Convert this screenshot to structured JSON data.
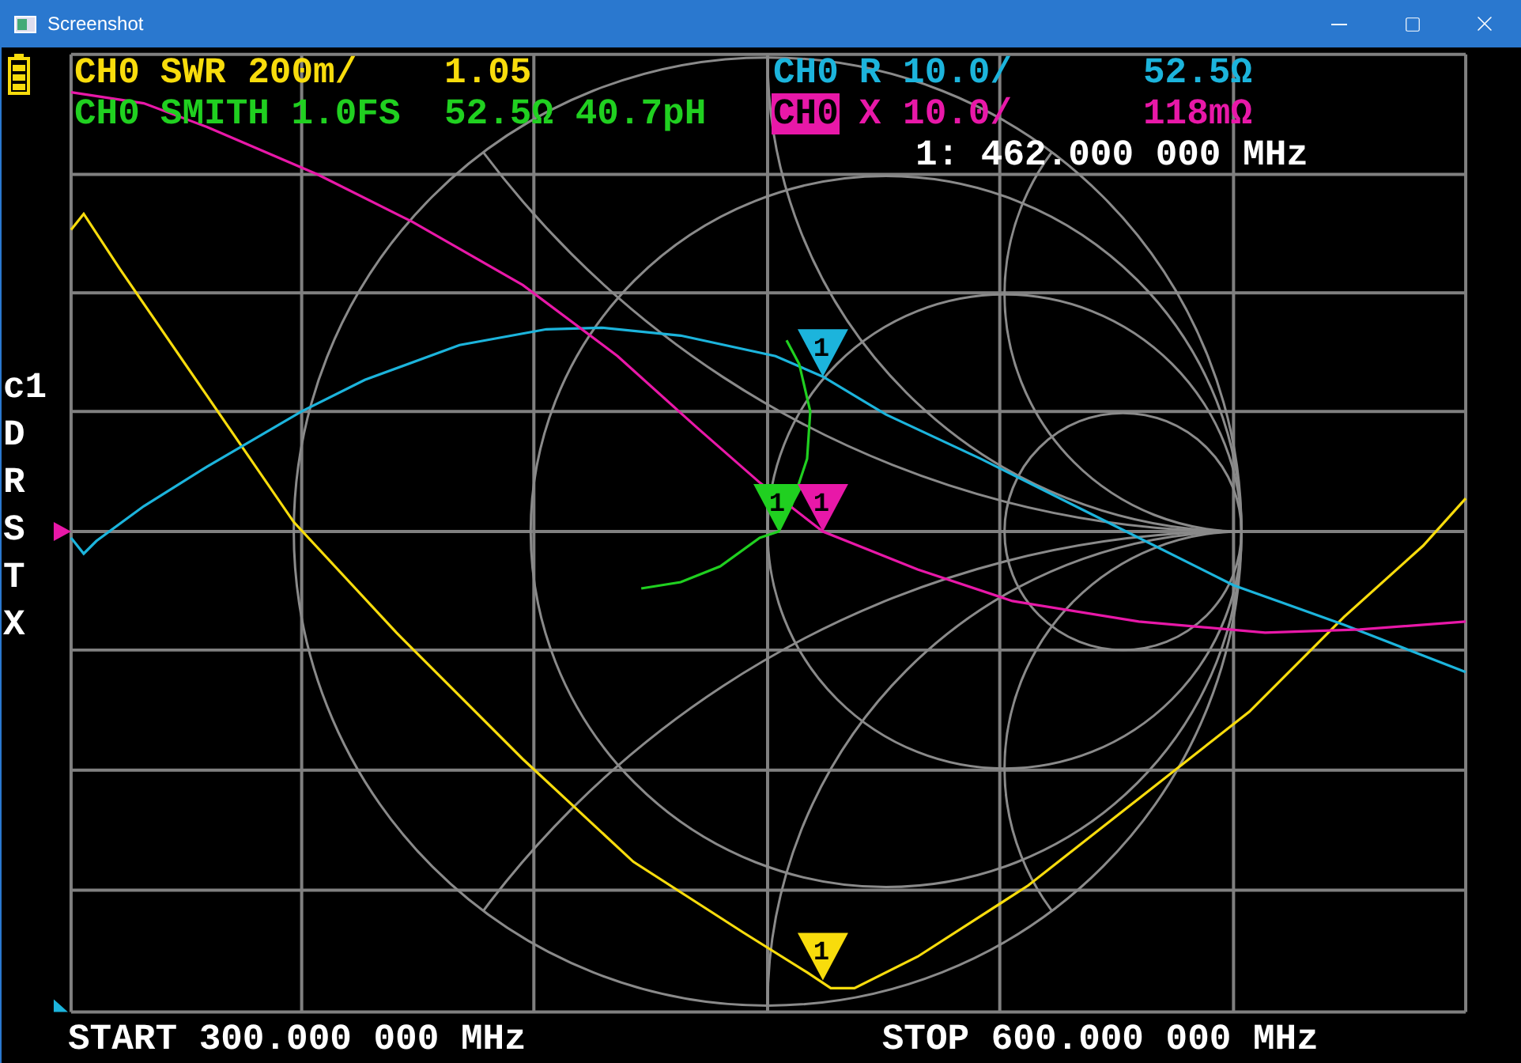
{
  "window": {
    "title": "Screenshot"
  },
  "traces": [
    {
      "channel": "CH0",
      "format": "SWR 200m/",
      "value": "1.05",
      "color": "#f8dc0c",
      "selected": false
    },
    {
      "channel": "CH0",
      "format": "R 10.0/",
      "value": "52.5Ω",
      "color": "#1cb4dc",
      "selected": false
    },
    {
      "channel": "CH0",
      "format": "SMITH 1.0FS",
      "value": "52.5Ω 40.7pH",
      "color": "#20d020",
      "selected": false
    },
    {
      "channel": "CH0",
      "format": "X 10.0/",
      "value": "118mΩ",
      "color": "#e818a8",
      "selected": true
    }
  ],
  "markers": [
    {
      "label": "1",
      "color": "#1cb4dc"
    },
    {
      "label": "1",
      "color": "#20d020"
    },
    {
      "label": "1",
      "color": "#e818a8"
    },
    {
      "label": "1",
      "color": "#f8dc0c"
    }
  ],
  "marker_readout": "1: 462.000 000 MHz",
  "side_menu": [
    "c1",
    "D",
    "R",
    "S",
    "T",
    "X"
  ],
  "start": "START 300.000 000 MHz",
  "stop": "STOP 600.000 000 MHz"
}
